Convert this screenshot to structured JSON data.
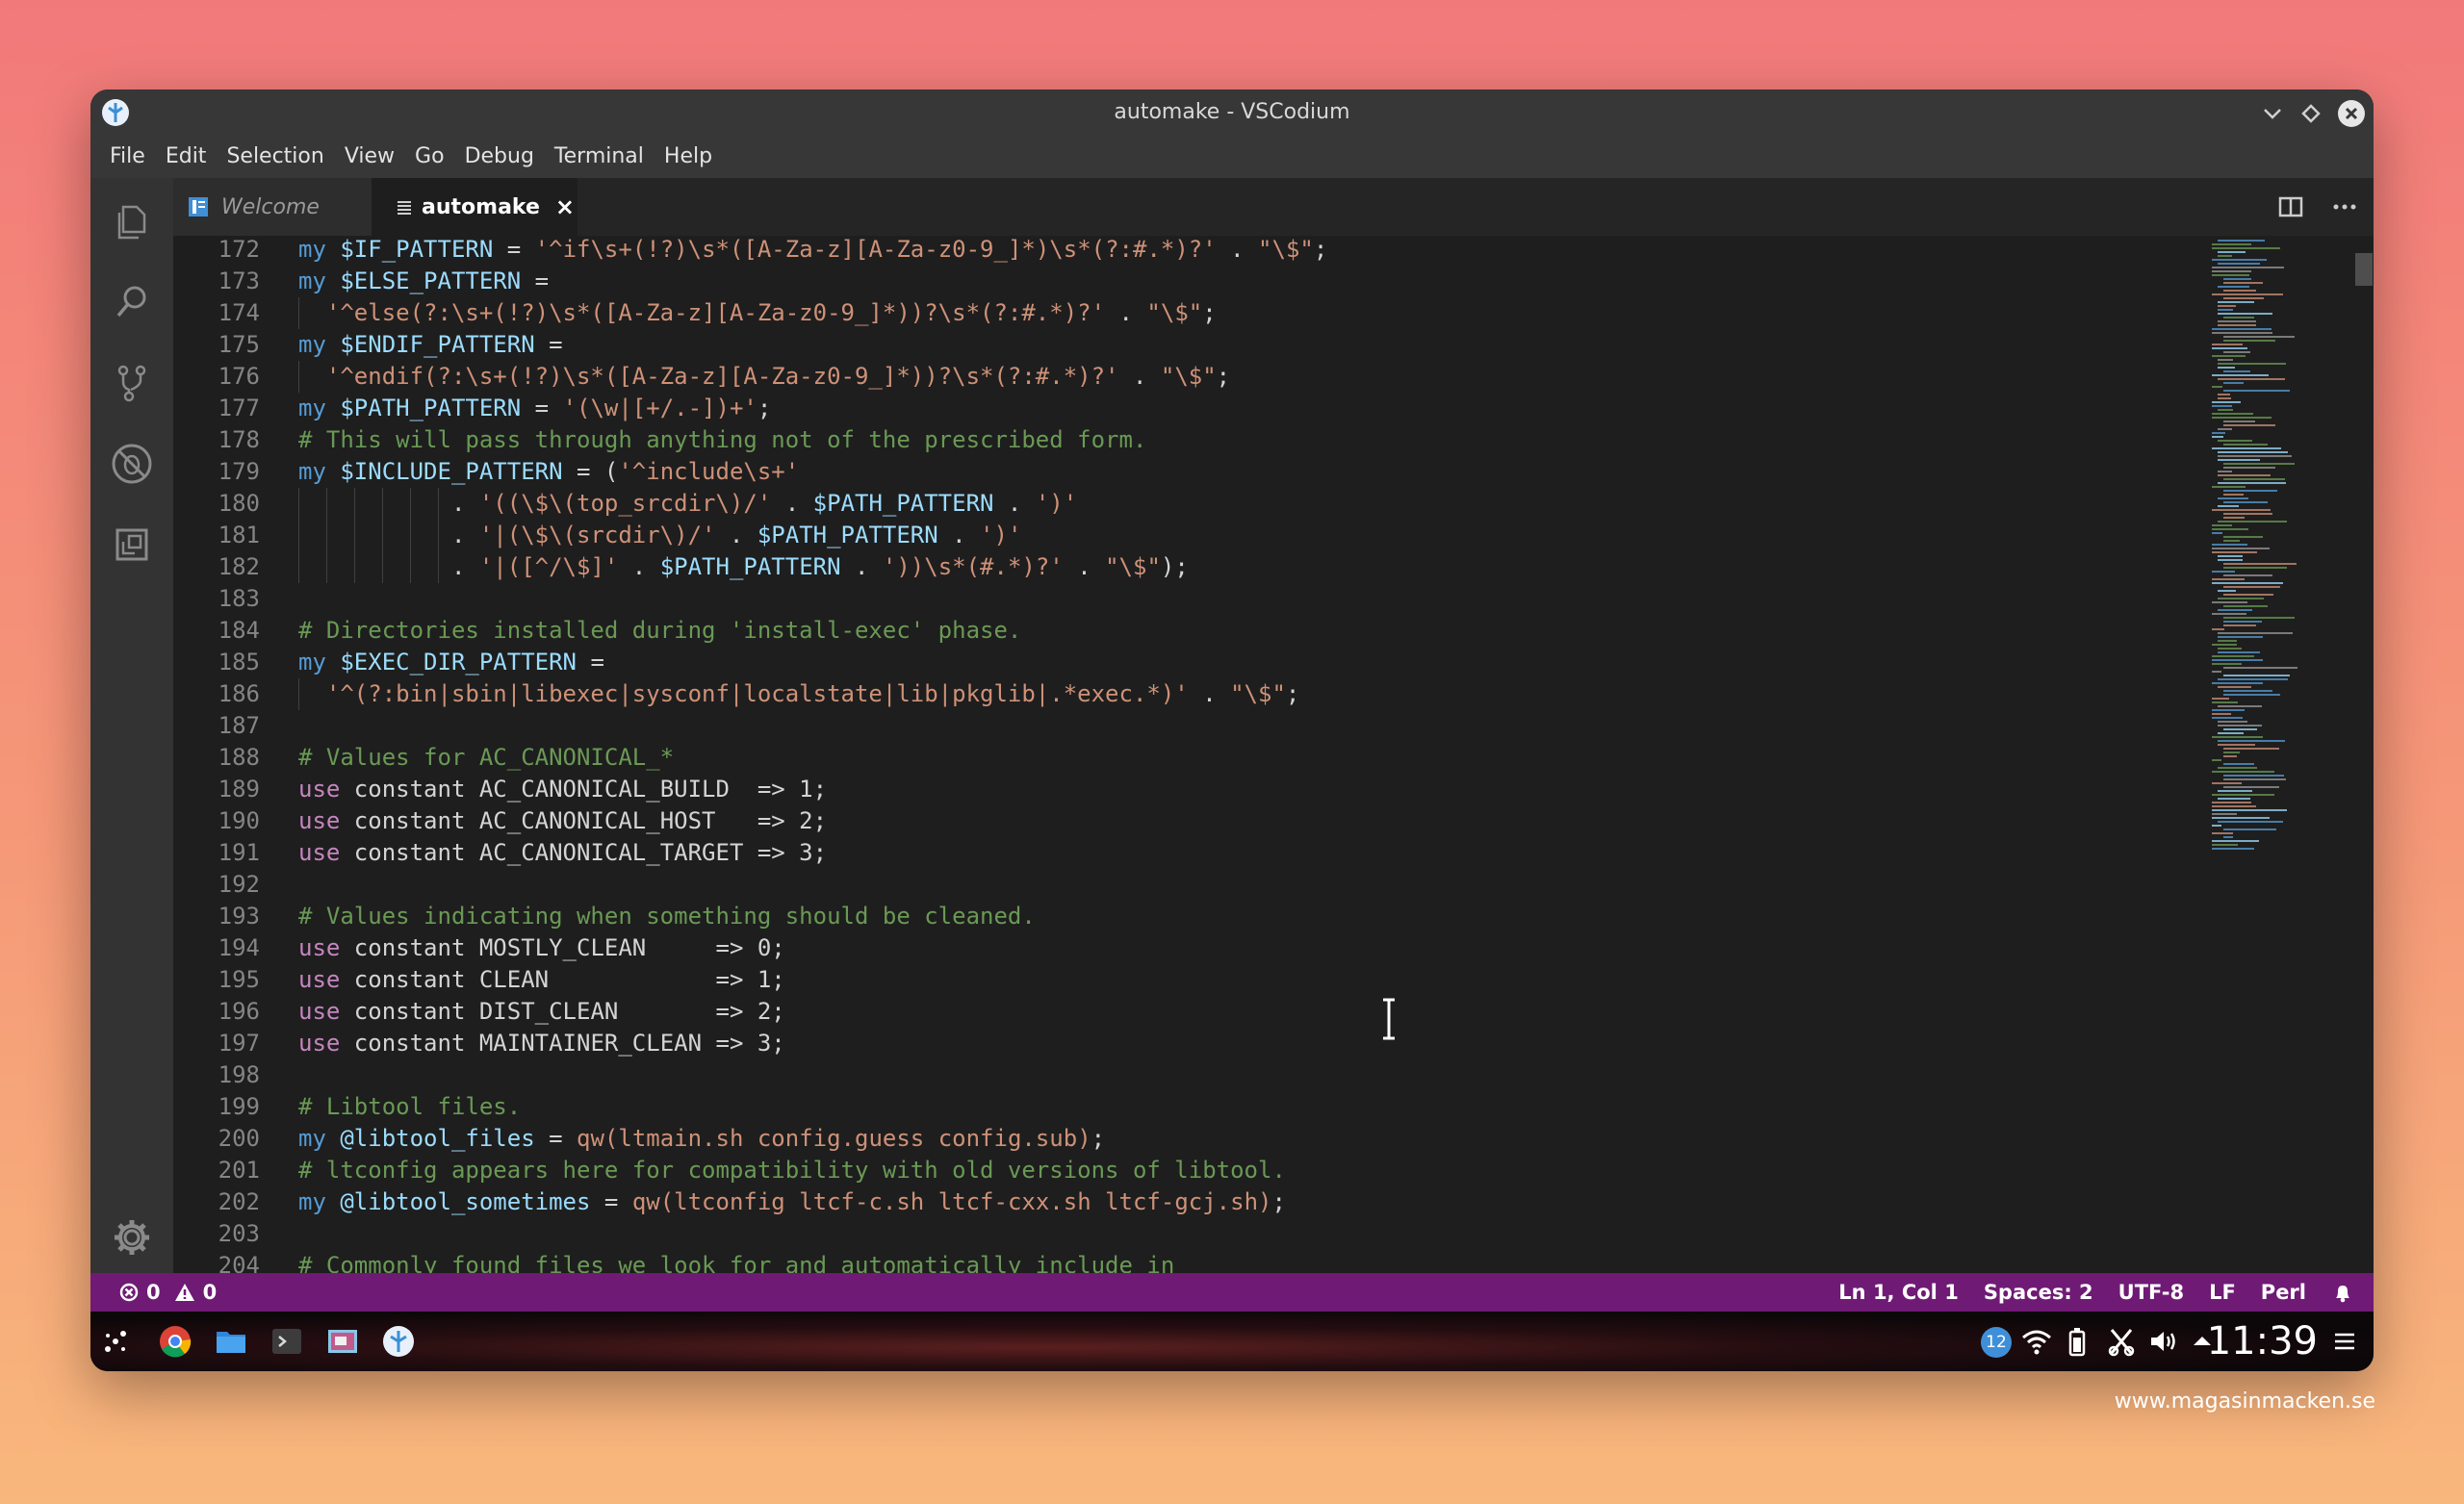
{
  "window": {
    "title": "automake - VSCodium"
  },
  "menu": [
    "File",
    "Edit",
    "Selection",
    "View",
    "Go",
    "Debug",
    "Terminal",
    "Help"
  ],
  "tabs": {
    "welcome": "Welcome",
    "active": "automake",
    "close": "×"
  },
  "code_lines": [
    {
      "n": "172",
      "indent": 0,
      "tokens": [
        {
          "t": "my ",
          "c": "kw"
        },
        {
          "t": "$IF_PATTERN",
          "c": "var"
        },
        {
          "t": " = ",
          "c": "plain"
        },
        {
          "t": "'^if\\s+(!?)\\s*([A-Za-z][A-Za-z0-9_]*)\\s*(?:#.*)?'",
          "c": "str"
        },
        {
          "t": " . ",
          "c": "plain"
        },
        {
          "t": "\"\\$\"",
          "c": "str"
        },
        {
          "t": ";",
          "c": "plain"
        }
      ]
    },
    {
      "n": "173",
      "indent": 0,
      "tokens": [
        {
          "t": "my ",
          "c": "kw"
        },
        {
          "t": "$ELSE_PATTERN",
          "c": "var"
        },
        {
          "t": " =",
          "c": "plain"
        }
      ]
    },
    {
      "n": "174",
      "indent": 1,
      "tokens": [
        {
          "t": "  '^else(?:\\s+(!?)\\s*([A-Za-z][A-Za-z0-9_]*))?\\s*(?:#.*)?'",
          "c": "str"
        },
        {
          "t": " . ",
          "c": "plain"
        },
        {
          "t": "\"\\$\"",
          "c": "str"
        },
        {
          "t": ";",
          "c": "plain"
        }
      ]
    },
    {
      "n": "175",
      "indent": 0,
      "tokens": [
        {
          "t": "my ",
          "c": "kw"
        },
        {
          "t": "$ENDIF_PATTERN",
          "c": "var"
        },
        {
          "t": " =",
          "c": "plain"
        }
      ]
    },
    {
      "n": "176",
      "indent": 1,
      "tokens": [
        {
          "t": "  '^endif(?:\\s+(!?)\\s*([A-Za-z][A-Za-z0-9_]*))?\\s*(?:#.*)?'",
          "c": "str"
        },
        {
          "t": " . ",
          "c": "plain"
        },
        {
          "t": "\"\\$\"",
          "c": "str"
        },
        {
          "t": ";",
          "c": "plain"
        }
      ]
    },
    {
      "n": "177",
      "indent": 0,
      "tokens": [
        {
          "t": "my ",
          "c": "kw"
        },
        {
          "t": "$PATH_PATTERN",
          "c": "var"
        },
        {
          "t": " = ",
          "c": "plain"
        },
        {
          "t": "'(\\w|[+/.-])+'",
          "c": "str"
        },
        {
          "t": ";",
          "c": "plain"
        }
      ]
    },
    {
      "n": "178",
      "indent": 0,
      "tokens": [
        {
          "t": "# This will pass through anything not of the prescribed form.",
          "c": "com"
        }
      ]
    },
    {
      "n": "179",
      "indent": 0,
      "tokens": [
        {
          "t": "my ",
          "c": "kw"
        },
        {
          "t": "$INCLUDE_PATTERN",
          "c": "var"
        },
        {
          "t": " = (",
          "c": "plain"
        },
        {
          "t": "'^include\\s+'",
          "c": "str"
        }
      ]
    },
    {
      "n": "180",
      "indent": 6,
      "tokens": [
        {
          "t": "           . ",
          "c": "plain"
        },
        {
          "t": "'((\\$\\(top_srcdir\\)/'",
          "c": "str"
        },
        {
          "t": " . ",
          "c": "plain"
        },
        {
          "t": "$PATH_PATTERN",
          "c": "var"
        },
        {
          "t": " . ",
          "c": "plain"
        },
        {
          "t": "')'",
          "c": "str"
        }
      ]
    },
    {
      "n": "181",
      "indent": 6,
      "tokens": [
        {
          "t": "           . ",
          "c": "plain"
        },
        {
          "t": "'|(\\$\\(srcdir\\)/'",
          "c": "str"
        },
        {
          "t": " . ",
          "c": "plain"
        },
        {
          "t": "$PATH_PATTERN",
          "c": "var"
        },
        {
          "t": " . ",
          "c": "plain"
        },
        {
          "t": "')'",
          "c": "str"
        }
      ]
    },
    {
      "n": "182",
      "indent": 6,
      "tokens": [
        {
          "t": "           . ",
          "c": "plain"
        },
        {
          "t": "'|([^/\\$]'",
          "c": "str"
        },
        {
          "t": " . ",
          "c": "plain"
        },
        {
          "t": "$PATH_PATTERN",
          "c": "var"
        },
        {
          "t": " . ",
          "c": "plain"
        },
        {
          "t": "'))\\s*(#.*)?'",
          "c": "str"
        },
        {
          "t": " . ",
          "c": "plain"
        },
        {
          "t": "\"\\$\"",
          "c": "str"
        },
        {
          "t": ");",
          "c": "plain"
        }
      ]
    },
    {
      "n": "183",
      "indent": 0,
      "tokens": []
    },
    {
      "n": "184",
      "indent": 0,
      "tokens": [
        {
          "t": "# Directories installed during 'install-exec' phase.",
          "c": "com"
        }
      ]
    },
    {
      "n": "185",
      "indent": 0,
      "tokens": [
        {
          "t": "my ",
          "c": "kw"
        },
        {
          "t": "$EXEC_DIR_PATTERN",
          "c": "var"
        },
        {
          "t": " =",
          "c": "plain"
        }
      ]
    },
    {
      "n": "186",
      "indent": 1,
      "tokens": [
        {
          "t": "  '^(?:bin|sbin|libexec|sysconf|localstate|lib|pkglib|.*exec.*)'",
          "c": "str"
        },
        {
          "t": " . ",
          "c": "plain"
        },
        {
          "t": "\"\\$\"",
          "c": "str"
        },
        {
          "t": ";",
          "c": "plain"
        }
      ]
    },
    {
      "n": "187",
      "indent": 0,
      "tokens": []
    },
    {
      "n": "188",
      "indent": 0,
      "tokens": [
        {
          "t": "# Values for AC_CANONICAL_*",
          "c": "com"
        }
      ]
    },
    {
      "n": "189",
      "indent": 0,
      "tokens": [
        {
          "t": "use",
          "c": "use"
        },
        {
          "t": " constant AC_CANONICAL_BUILD  => 1;",
          "c": "plain"
        }
      ]
    },
    {
      "n": "190",
      "indent": 0,
      "tokens": [
        {
          "t": "use",
          "c": "use"
        },
        {
          "t": " constant AC_CANONICAL_HOST   => 2;",
          "c": "plain"
        }
      ]
    },
    {
      "n": "191",
      "indent": 0,
      "tokens": [
        {
          "t": "use",
          "c": "use"
        },
        {
          "t": " constant AC_CANONICAL_TARGET => 3;",
          "c": "plain"
        }
      ]
    },
    {
      "n": "192",
      "indent": 0,
      "tokens": []
    },
    {
      "n": "193",
      "indent": 0,
      "tokens": [
        {
          "t": "# Values indicating when something should be cleaned.",
          "c": "com"
        }
      ]
    },
    {
      "n": "194",
      "indent": 0,
      "tokens": [
        {
          "t": "use",
          "c": "use"
        },
        {
          "t": " constant MOSTLY_CLEAN     => 0;",
          "c": "plain"
        }
      ]
    },
    {
      "n": "195",
      "indent": 0,
      "tokens": [
        {
          "t": "use",
          "c": "use"
        },
        {
          "t": " constant CLEAN            => 1;",
          "c": "plain"
        }
      ]
    },
    {
      "n": "196",
      "indent": 0,
      "tokens": [
        {
          "t": "use",
          "c": "use"
        },
        {
          "t": " constant DIST_CLEAN       => 2;",
          "c": "plain"
        }
      ]
    },
    {
      "n": "197",
      "indent": 0,
      "tokens": [
        {
          "t": "use",
          "c": "use"
        },
        {
          "t": " constant MAINTAINER_CLEAN => 3;",
          "c": "plain"
        }
      ]
    },
    {
      "n": "198",
      "indent": 0,
      "tokens": []
    },
    {
      "n": "199",
      "indent": 0,
      "tokens": [
        {
          "t": "# Libtool files.",
          "c": "com"
        }
      ]
    },
    {
      "n": "200",
      "indent": 0,
      "tokens": [
        {
          "t": "my ",
          "c": "kw"
        },
        {
          "t": "@libtool_files",
          "c": "var"
        },
        {
          "t": " = ",
          "c": "plain"
        },
        {
          "t": "qw(ltmain.sh config.guess config.sub)",
          "c": "str"
        },
        {
          "t": ";",
          "c": "plain"
        }
      ]
    },
    {
      "n": "201",
      "indent": 0,
      "tokens": [
        {
          "t": "# ltconfig appears here for compatibility with old versions of libtool.",
          "c": "com"
        }
      ]
    },
    {
      "n": "202",
      "indent": 0,
      "tokens": [
        {
          "t": "my ",
          "c": "kw"
        },
        {
          "t": "@libtool_sometimes",
          "c": "var"
        },
        {
          "t": " = ",
          "c": "plain"
        },
        {
          "t": "qw(ltconfig ltcf-c.sh ltcf-cxx.sh ltcf-gcj.sh)",
          "c": "str"
        },
        {
          "t": ";",
          "c": "plain"
        }
      ]
    },
    {
      "n": "203",
      "indent": 0,
      "tokens": []
    },
    {
      "n": "204",
      "indent": 0,
      "tokens": [
        {
          "t": "# Commonly found files we look for and automatically include in",
          "c": "com"
        }
      ]
    }
  ],
  "status": {
    "errors": "0",
    "warnings": "0",
    "position": "Ln 1, Col 1",
    "spaces": "Spaces: 2",
    "encoding": "UTF-8",
    "eol": "LF",
    "language": "Perl"
  },
  "taskbar": {
    "clock": "11:39",
    "notification_count": "12"
  },
  "watermark": "www.magasinmacken.se",
  "colors": {
    "statusbar": "#6f1a75",
    "keyword": "#569cd6",
    "variable": "#9cdcfe",
    "string": "#ce9178",
    "comment": "#6a9955",
    "use_keyword": "#c586c0"
  },
  "icons": [
    "app-icon",
    "explorer-icon",
    "search-icon",
    "source-control-icon",
    "debug-icon",
    "extensions-icon",
    "settings-gear-icon",
    "split-editor-icon",
    "more-actions-icon",
    "chrome-icon",
    "files-icon",
    "terminal-icon",
    "screenshot-icon",
    "vscodium-icon",
    "wifi-icon",
    "battery-icon",
    "volume-icon",
    "bell-icon"
  ]
}
